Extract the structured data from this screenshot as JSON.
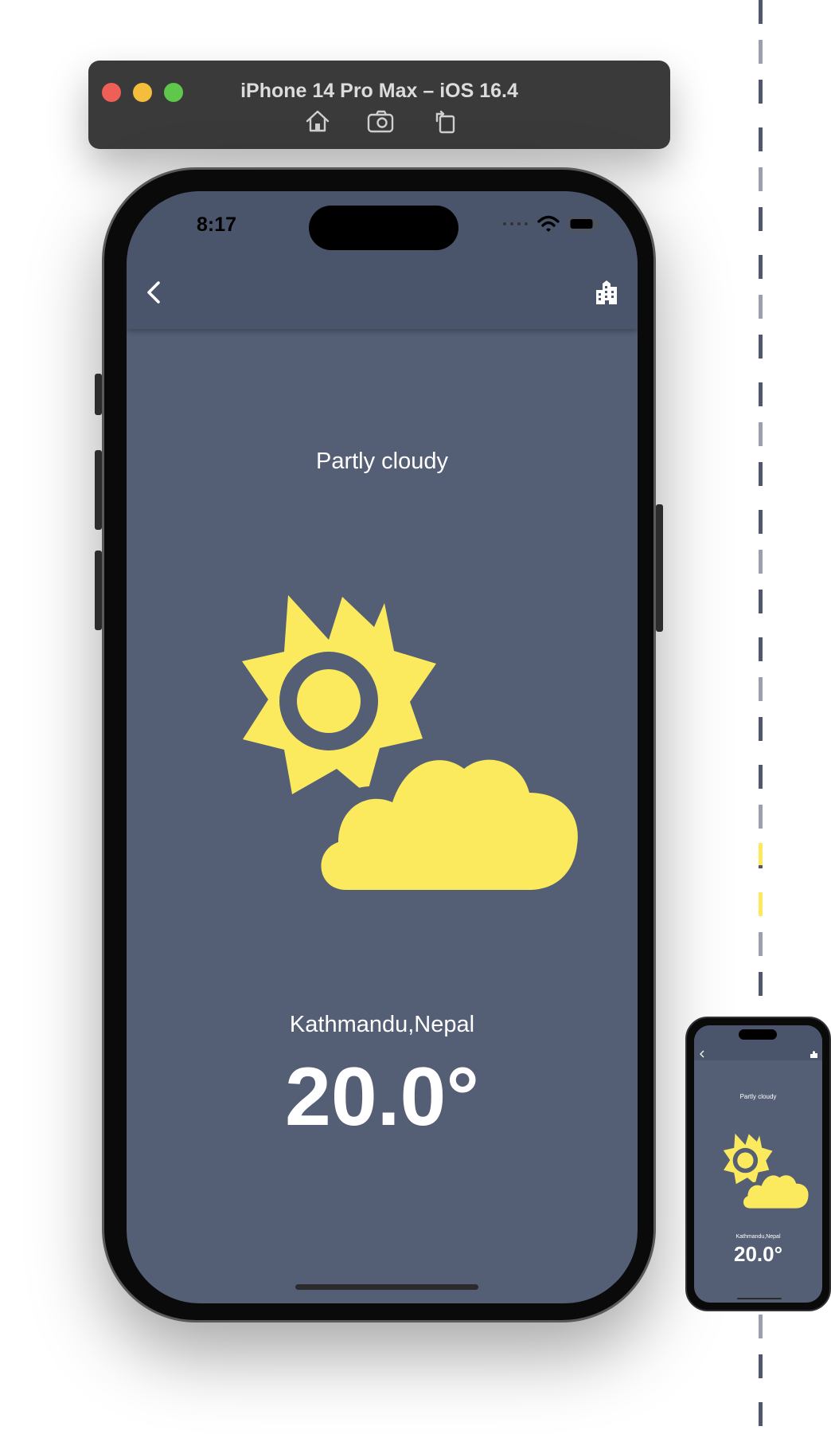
{
  "simulator": {
    "title": "iPhone 14 Pro Max – iOS 16.4",
    "tools": [
      {
        "icon": "home-icon"
      },
      {
        "icon": "screenshot-icon"
      },
      {
        "icon": "rotate-icon"
      }
    ]
  },
  "status_bar": {
    "time": "8:17",
    "icons": [
      "cellular-icon",
      "wifi-icon",
      "battery-icon"
    ]
  },
  "app_bar": {
    "back_icon": "chevron-left-icon",
    "action_icon": "city-icon"
  },
  "weather": {
    "description": "Partly cloudy",
    "icon": "partly-cloudy-icon",
    "location": "Kathmandu,Nepal",
    "temperature": "20.0°"
  },
  "mini_preview": {
    "description": "Partly cloudy",
    "location": "Kathmandu,Nepal",
    "temperature": "20.0°"
  },
  "colors": {
    "screen_background": "#545e75",
    "app_bar_background": "#4a546b",
    "icon_yellow": "#fbea5e",
    "text": "#ffffff"
  }
}
